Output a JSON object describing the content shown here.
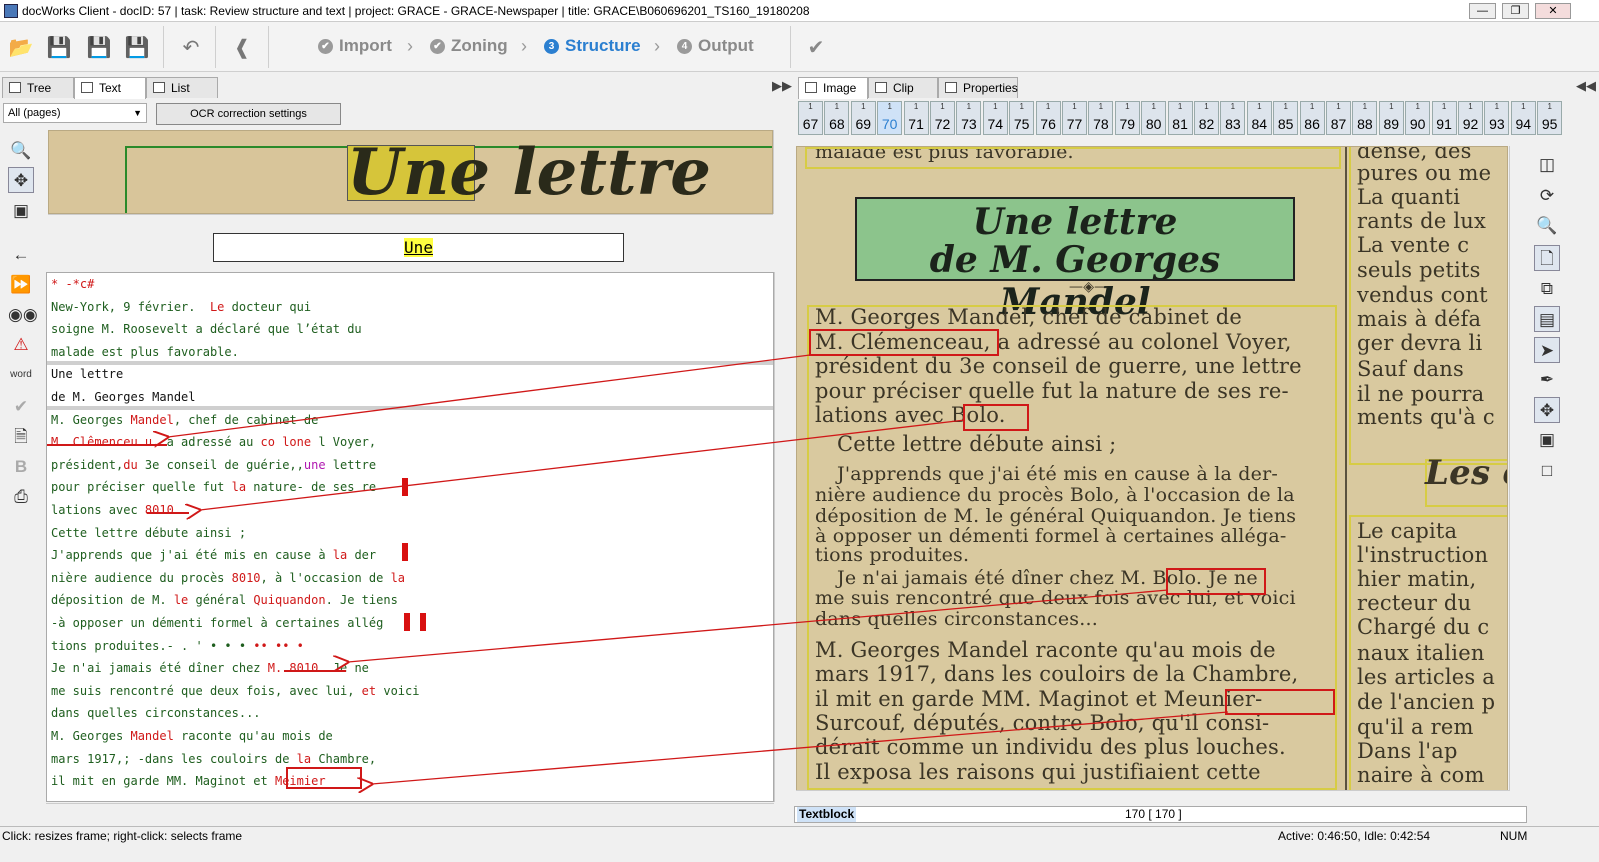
{
  "window": {
    "title": "docWorks Client - docID: 57 | task: Review structure and text | project: GRACE - GRACE-Newspaper | title: GRACE\\B060696201_TS160_19180208",
    "minimize": "—",
    "restore": "❐",
    "close": "✕"
  },
  "toolbar": {
    "steps": [
      {
        "num": "✔",
        "label": "Import"
      },
      {
        "num": "✔",
        "label": "Zoning"
      },
      {
        "num": "3",
        "label": "Structure"
      },
      {
        "num": "4",
        "label": "Output"
      }
    ],
    "chevron": "›"
  },
  "left_tabs": [
    {
      "label": "Tree"
    },
    {
      "label": "Text"
    },
    {
      "label": "List"
    }
  ],
  "page_select": {
    "value": "All (pages)"
  },
  "ocr_button": "OCR correction settings",
  "scan_top_word": "Une   lettre",
  "current_word": "Une",
  "text_lines": [
    {
      "segments": [
        {
          "t": "* -*c#",
          "c": "red"
        }
      ]
    },
    {
      "segments": [
        {
          "t": "New-York, 9 février.  ",
          "c": "g"
        },
        {
          "t": "Le",
          "c": "red"
        },
        {
          "t": " docteur qui",
          "c": "g"
        }
      ]
    },
    {
      "segments": [
        {
          "t": "soigne M. Roosevelt a déclaré que l’état du",
          "c": "g"
        }
      ]
    },
    {
      "segments": [
        {
          "t": "malade est plus favorable.",
          "c": "g"
        }
      ]
    },
    {
      "segments": [
        {
          "t": "Une lettre",
          "c": "b"
        }
      ]
    },
    {
      "segments": [
        {
          "t": "de M. Georges Mandel",
          "c": "b"
        }
      ]
    },
    {
      "segments": [
        {
          "t": "M. Georges ",
          "c": "g"
        },
        {
          "t": "Mandel",
          "c": "red"
        },
        {
          "t": ", chef de cabinet de",
          "c": "g"
        }
      ]
    },
    {
      "segments": [
        {
          "t": "M. Clêmenceu u,",
          "c": "red"
        },
        {
          "t": " a adressé au ",
          "c": "g"
        },
        {
          "t": "co lone",
          "c": "red"
        },
        {
          "t": " l Voyer,",
          "c": "g"
        }
      ]
    },
    {
      "segments": [
        {
          "t": "président,",
          "c": "g"
        },
        {
          "t": "du",
          "c": "red"
        },
        {
          "t": " 3e conseil de guérie,,",
          "c": "g"
        },
        {
          "t": "une",
          "c": "purple"
        },
        {
          "t": " lettre",
          "c": "g"
        }
      ]
    },
    {
      "segments": [
        {
          "t": "pour préciser quelle fut ",
          "c": "g"
        },
        {
          "t": "la",
          "c": "red"
        },
        {
          "t": " nature- de ses re",
          "c": "g"
        }
      ]
    },
    {
      "segments": [
        {
          "t": "lations avec ",
          "c": "g"
        },
        {
          "t": "8010",
          "c": "red"
        },
        {
          "t": ".",
          "c": "g"
        }
      ]
    },
    {
      "segments": [
        {
          "t": "Cette lettre débute ainsi ;",
          "c": "g"
        }
      ]
    },
    {
      "segments": [
        {
          "t": "J'apprends que j'ai été mis en cause ",
          "c": "g"
        },
        {
          "t": "à",
          "c": "g"
        },
        {
          "t": " la",
          "c": "red"
        },
        {
          "t": " der",
          "c": "g"
        }
      ]
    },
    {
      "segments": [
        {
          "t": "nière audience du procès ",
          "c": "g"
        },
        {
          "t": "8010",
          "c": "red"
        },
        {
          "t": ", à l'occasion de ",
          "c": "g"
        },
        {
          "t": "la",
          "c": "red"
        }
      ]
    },
    {
      "segments": [
        {
          "t": "déposition de M. ",
          "c": "g"
        },
        {
          "t": "le",
          "c": "red"
        },
        {
          "t": " général ",
          "c": "g"
        },
        {
          "t": "Quiquandon",
          "c": "red"
        },
        {
          "t": ". Je tiens",
          "c": "g"
        }
      ]
    },
    {
      "segments": [
        {
          "t": "-à opposer un démenti formel à certaines allég",
          "c": "g"
        }
      ]
    },
    {
      "segments": [
        {
          "t": "tions produites.- . ' • • •",
          "c": "g"
        },
        {
          "t": " •• •• •",
          "c": "red"
        }
      ]
    },
    {
      "segments": [
        {
          "t": "Je n'ai jamais été dîner chez ",
          "c": "g"
        },
        {
          "t": "M. 8010.",
          "c": "red"
        },
        {
          "t": " Je ne",
          "c": "g"
        }
      ]
    },
    {
      "segments": [
        {
          "t": "me suis rencontré que deux fois, avec lui, ",
          "c": "g"
        },
        {
          "t": "et",
          "c": "red"
        },
        {
          "t": " voici",
          "c": "g"
        }
      ]
    },
    {
      "segments": [
        {
          "t": "dans quelles circonstances...",
          "c": "g"
        }
      ]
    },
    {
      "segments": [
        {
          "t": "M. Georges ",
          "c": "g"
        },
        {
          "t": "Mandel",
          "c": "red"
        },
        {
          "t": " raconte qu'au mois de",
          "c": "g"
        }
      ]
    },
    {
      "segments": [
        {
          "t": "mars 1917,; -dans les couloirs de ",
          "c": "g"
        },
        {
          "t": "la",
          "c": "red"
        },
        {
          "t": " Chambre,",
          "c": "g"
        }
      ]
    },
    {
      "segments": [
        {
          "t": "il mit en garde MM. Maginot et ",
          "c": "g"
        },
        {
          "t": "Meimier",
          "c": "red"
        }
      ]
    }
  ],
  "right_tabs": [
    {
      "label": "Image"
    },
    {
      "label": "Clip"
    },
    {
      "label": "Properties"
    }
  ],
  "pages": [
    "67",
    "68",
    "69",
    "70",
    "71",
    "72",
    "73",
    "74",
    "75",
    "76",
    "77",
    "78",
    "79",
    "80",
    "81",
    "82",
    "83",
    "84",
    "85",
    "86",
    "87",
    "88",
    "89",
    "90",
    "91",
    "92",
    "93",
    "94",
    "95"
  ],
  "page_top": "1",
  "selected_page": "70",
  "newspaper": {
    "top_line": "malade est plus favorable.",
    "headline1": "Une lettre",
    "headline2": "de M. Georges Mandel",
    "body": [
      "M. Georges Mandel, chef de cabinet de",
      "M. Clémenceau, a adressé au colonel Voyer,",
      "président du 3e conseil de guerre, une lettre",
      "pour préciser quelle fut la nature de ses re-",
      "lations avec Bolo.",
      "Cette lettre débute ainsi ;",
      "J'apprends que j'ai été mis en cause à la der-",
      "nière audience du procès Bolo, à l'occasion de la",
      "déposition de M. le général Quiquandon. Je tiens",
      "à opposer un démenti formel à certaines alléga-",
      "tions produites.",
      "Je n'ai jamais été dîner chez M. Bolo. Je ne",
      "me suis rencontré que deux fois avec lui, et voici",
      "dans quelles circonstances...",
      "M. Georges Mandel raconte qu'au mois de",
      "mars 1917, dans les couloirs de la Chambre,",
      "il mit en garde MM. Maginot et Meunier-",
      "Surcouf, députés, contre Bolo, qu'il consi-",
      "dérait comme un individu des plus louches.",
      "Il exposa les raisons qui justifiaient cette"
    ],
    "right_col": [
      "dense, des",
      "pures ou me",
      "La quanti",
      "rants de lux",
      "La vente c",
      "seuls petits",
      "vendus cont",
      "mais à défa",
      "ger devra li",
      "Sauf dans",
      "il ne pourra",
      "ments qu'à c",
      "Les c",
      "Le capita",
      "l'instruction",
      "hier matin,",
      "recteur du",
      "Chargé du c",
      "naux italien",
      "les articles a",
      "de l'ancien p",
      "qu'il a rem",
      "Dans l'ap",
      "naire à com"
    ]
  },
  "textblock": {
    "label": "Textblock",
    "count": "170 [ 170 ]"
  },
  "status": {
    "hint": "Click: resizes frame; right-click: selects frame",
    "activity": "Active: 0:46:50, Idle: 0:42:54",
    "num": "NUM"
  },
  "colors": {
    "accent": "#2b7fd0",
    "error": "#d01818",
    "ok_text": "#1e5e1e",
    "highlight": "#ffff40"
  }
}
